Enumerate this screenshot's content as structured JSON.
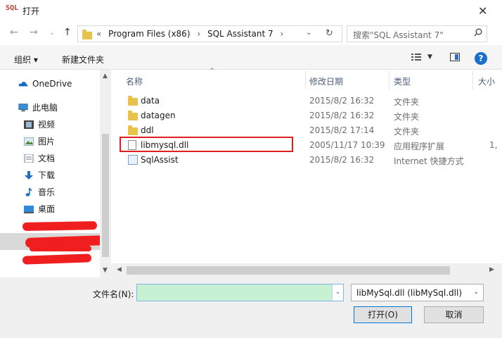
{
  "window": {
    "title": "打开",
    "app_icon_text": "SQL"
  },
  "address": {
    "crumbs": [
      "«",
      "Program Files (x86)",
      "›",
      "SQL Assistant 7",
      "›"
    ],
    "search_placeholder": "搜索\"SQL Assistant 7\""
  },
  "toolbar": {
    "organize": "组织 ▾",
    "new_folder": "新建文件夹"
  },
  "nav": {
    "onedrive": "OneDrive",
    "this_pc": "此电脑",
    "videos": "视频",
    "pictures": "图片",
    "documents": "文档",
    "downloads": "下载",
    "music": "音乐",
    "desktop": "桌面"
  },
  "columns": {
    "name": "名称",
    "modified": "修改日期",
    "type": "类型",
    "size": "大小"
  },
  "files": [
    {
      "name": "data",
      "date": "2015/8/2 16:32",
      "type": "文件夹",
      "size": ""
    },
    {
      "name": "datagen",
      "date": "2015/8/2 16:32",
      "type": "文件夹",
      "size": ""
    },
    {
      "name": "ddl",
      "date": "2015/8/2 17:14",
      "type": "文件夹",
      "size": ""
    },
    {
      "name": "libmysql.dll",
      "date": "2005/11/17 10:39",
      "type": "应用程序扩展",
      "size": "1,"
    },
    {
      "name": "SqlAssist",
      "date": "2015/8/2 16:32",
      "type": "Internet 快捷方式",
      "size": ""
    }
  ],
  "bottom": {
    "filename_label": "文件名(N):",
    "filename_value": "",
    "file_type": "libMySql.dll (libMySql.dll)",
    "open_button": "打开(O)",
    "cancel_button": "取消"
  },
  "colors": {
    "highlight": "#e02020",
    "filename_bg": "#c6f1d2",
    "folder": "#e8c24a",
    "accent": "#0078d7"
  }
}
